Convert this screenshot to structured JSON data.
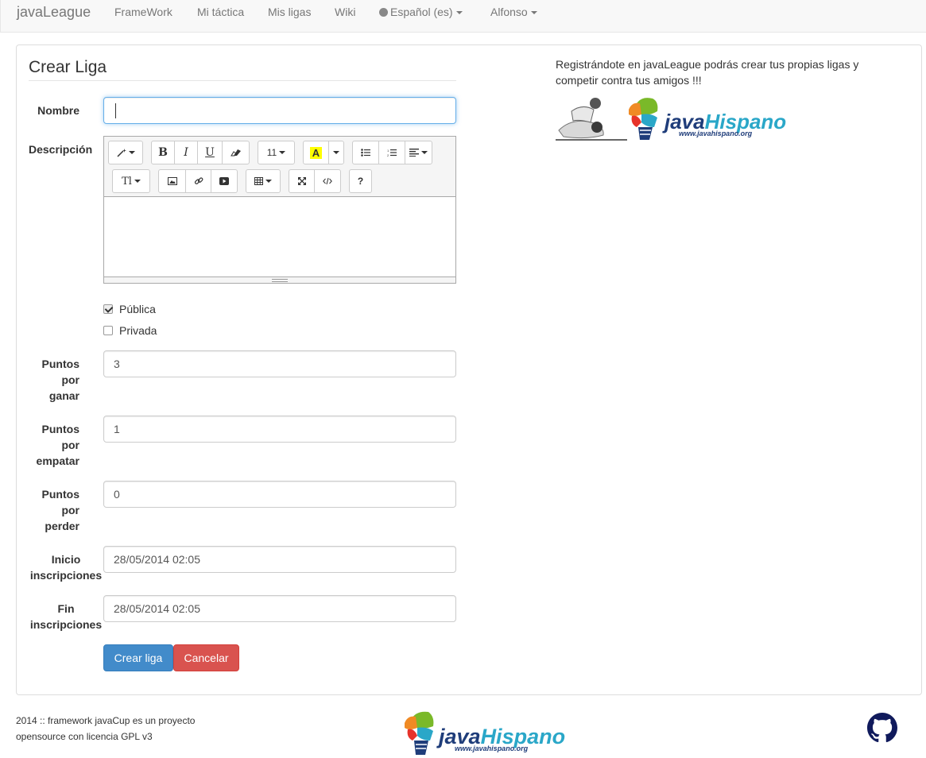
{
  "navbar": {
    "brand": "javaLeague",
    "items": [
      "FrameWork",
      "Mi táctica",
      "Mis ligas",
      "Wiki"
    ],
    "language": "Español (es)",
    "user": "Alfonso"
  },
  "form": {
    "title": "Crear Liga",
    "labels": {
      "nombre": "Nombre",
      "descripcion": "Descripción",
      "puntos_ganar": [
        "Puntos",
        "por",
        "ganar"
      ],
      "puntos_empatar": [
        "Puntos",
        "por",
        "empatar"
      ],
      "puntos_perder": [
        "Puntos",
        "por",
        "perder"
      ],
      "inicio": [
        "Inicio",
        "inscripciones"
      ],
      "fin": [
        "Fin",
        "inscripciones"
      ]
    },
    "values": {
      "nombre": "",
      "puntos_ganar": "3",
      "puntos_empatar": "1",
      "puntos_perder": "0",
      "inicio": "28/05/2014 02:05",
      "fin": "28/05/2014 02:05"
    },
    "visibility": [
      {
        "label": "Pública",
        "checked": true
      },
      {
        "label": "Privada",
        "checked": false
      }
    ],
    "toolbar": {
      "font_size": "11",
      "highlight_letter": "A",
      "text_style": "Tl",
      "help": "?",
      "bold": "B",
      "italic": "I",
      "underline": "U"
    },
    "buttons": {
      "submit": "Crear liga",
      "cancel": "Cancelar"
    }
  },
  "sidebar": {
    "text": "Registrándote en javaLeague podrás crear tus propias ligas y competir contra tus amigos !!!",
    "logo_text": "javaHispano",
    "logo_url_text": "www.javahispano.org"
  },
  "footer": {
    "text": "2014 :: framework javaCup es un proyecto opensource con licencia GPL v3",
    "logo_text": "javaHispano",
    "logo_url_text": "www.javahispano.org"
  },
  "colors": {
    "primary": "#428bca",
    "danger": "#d9534f",
    "logo_blue": "#1f3d7a",
    "logo_cyan": "#2aa7c8",
    "github": "#101a5c"
  }
}
